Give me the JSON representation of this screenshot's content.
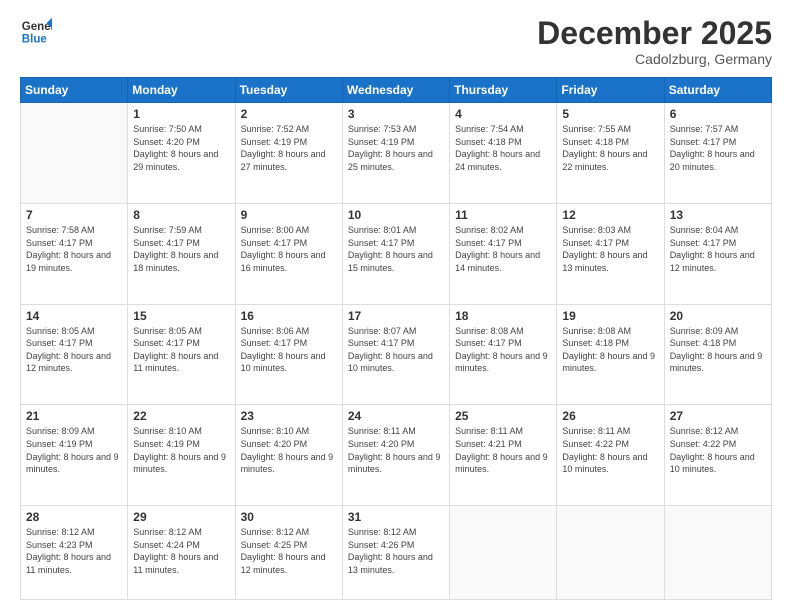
{
  "header": {
    "logo_line1": "General",
    "logo_line2": "Blue",
    "month_year": "December 2025",
    "location": "Cadolzburg, Germany"
  },
  "days_of_week": [
    "Sunday",
    "Monday",
    "Tuesday",
    "Wednesday",
    "Thursday",
    "Friday",
    "Saturday"
  ],
  "weeks": [
    [
      {
        "day": "",
        "sunrise": "",
        "sunset": "",
        "daylight": ""
      },
      {
        "day": "1",
        "sunrise": "Sunrise: 7:50 AM",
        "sunset": "Sunset: 4:20 PM",
        "daylight": "Daylight: 8 hours and 29 minutes."
      },
      {
        "day": "2",
        "sunrise": "Sunrise: 7:52 AM",
        "sunset": "Sunset: 4:19 PM",
        "daylight": "Daylight: 8 hours and 27 minutes."
      },
      {
        "day": "3",
        "sunrise": "Sunrise: 7:53 AM",
        "sunset": "Sunset: 4:19 PM",
        "daylight": "Daylight: 8 hours and 25 minutes."
      },
      {
        "day": "4",
        "sunrise": "Sunrise: 7:54 AM",
        "sunset": "Sunset: 4:18 PM",
        "daylight": "Daylight: 8 hours and 24 minutes."
      },
      {
        "day": "5",
        "sunrise": "Sunrise: 7:55 AM",
        "sunset": "Sunset: 4:18 PM",
        "daylight": "Daylight: 8 hours and 22 minutes."
      },
      {
        "day": "6",
        "sunrise": "Sunrise: 7:57 AM",
        "sunset": "Sunset: 4:17 PM",
        "daylight": "Daylight: 8 hours and 20 minutes."
      }
    ],
    [
      {
        "day": "7",
        "sunrise": "Sunrise: 7:58 AM",
        "sunset": "Sunset: 4:17 PM",
        "daylight": "Daylight: 8 hours and 19 minutes."
      },
      {
        "day": "8",
        "sunrise": "Sunrise: 7:59 AM",
        "sunset": "Sunset: 4:17 PM",
        "daylight": "Daylight: 8 hours and 18 minutes."
      },
      {
        "day": "9",
        "sunrise": "Sunrise: 8:00 AM",
        "sunset": "Sunset: 4:17 PM",
        "daylight": "Daylight: 8 hours and 16 minutes."
      },
      {
        "day": "10",
        "sunrise": "Sunrise: 8:01 AM",
        "sunset": "Sunset: 4:17 PM",
        "daylight": "Daylight: 8 hours and 15 minutes."
      },
      {
        "day": "11",
        "sunrise": "Sunrise: 8:02 AM",
        "sunset": "Sunset: 4:17 PM",
        "daylight": "Daylight: 8 hours and 14 minutes."
      },
      {
        "day": "12",
        "sunrise": "Sunrise: 8:03 AM",
        "sunset": "Sunset: 4:17 PM",
        "daylight": "Daylight: 8 hours and 13 minutes."
      },
      {
        "day": "13",
        "sunrise": "Sunrise: 8:04 AM",
        "sunset": "Sunset: 4:17 PM",
        "daylight": "Daylight: 8 hours and 12 minutes."
      }
    ],
    [
      {
        "day": "14",
        "sunrise": "Sunrise: 8:05 AM",
        "sunset": "Sunset: 4:17 PM",
        "daylight": "Daylight: 8 hours and 12 minutes."
      },
      {
        "day": "15",
        "sunrise": "Sunrise: 8:05 AM",
        "sunset": "Sunset: 4:17 PM",
        "daylight": "Daylight: 8 hours and 11 minutes."
      },
      {
        "day": "16",
        "sunrise": "Sunrise: 8:06 AM",
        "sunset": "Sunset: 4:17 PM",
        "daylight": "Daylight: 8 hours and 10 minutes."
      },
      {
        "day": "17",
        "sunrise": "Sunrise: 8:07 AM",
        "sunset": "Sunset: 4:17 PM",
        "daylight": "Daylight: 8 hours and 10 minutes."
      },
      {
        "day": "18",
        "sunrise": "Sunrise: 8:08 AM",
        "sunset": "Sunset: 4:17 PM",
        "daylight": "Daylight: 8 hours and 9 minutes."
      },
      {
        "day": "19",
        "sunrise": "Sunrise: 8:08 AM",
        "sunset": "Sunset: 4:18 PM",
        "daylight": "Daylight: 8 hours and 9 minutes."
      },
      {
        "day": "20",
        "sunrise": "Sunrise: 8:09 AM",
        "sunset": "Sunset: 4:18 PM",
        "daylight": "Daylight: 8 hours and 9 minutes."
      }
    ],
    [
      {
        "day": "21",
        "sunrise": "Sunrise: 8:09 AM",
        "sunset": "Sunset: 4:19 PM",
        "daylight": "Daylight: 8 hours and 9 minutes."
      },
      {
        "day": "22",
        "sunrise": "Sunrise: 8:10 AM",
        "sunset": "Sunset: 4:19 PM",
        "daylight": "Daylight: 8 hours and 9 minutes."
      },
      {
        "day": "23",
        "sunrise": "Sunrise: 8:10 AM",
        "sunset": "Sunset: 4:20 PM",
        "daylight": "Daylight: 8 hours and 9 minutes."
      },
      {
        "day": "24",
        "sunrise": "Sunrise: 8:11 AM",
        "sunset": "Sunset: 4:20 PM",
        "daylight": "Daylight: 8 hours and 9 minutes."
      },
      {
        "day": "25",
        "sunrise": "Sunrise: 8:11 AM",
        "sunset": "Sunset: 4:21 PM",
        "daylight": "Daylight: 8 hours and 9 minutes."
      },
      {
        "day": "26",
        "sunrise": "Sunrise: 8:11 AM",
        "sunset": "Sunset: 4:22 PM",
        "daylight": "Daylight: 8 hours and 10 minutes."
      },
      {
        "day": "27",
        "sunrise": "Sunrise: 8:12 AM",
        "sunset": "Sunset: 4:22 PM",
        "daylight": "Daylight: 8 hours and 10 minutes."
      }
    ],
    [
      {
        "day": "28",
        "sunrise": "Sunrise: 8:12 AM",
        "sunset": "Sunset: 4:23 PM",
        "daylight": "Daylight: 8 hours and 11 minutes."
      },
      {
        "day": "29",
        "sunrise": "Sunrise: 8:12 AM",
        "sunset": "Sunset: 4:24 PM",
        "daylight": "Daylight: 8 hours and 11 minutes."
      },
      {
        "day": "30",
        "sunrise": "Sunrise: 8:12 AM",
        "sunset": "Sunset: 4:25 PM",
        "daylight": "Daylight: 8 hours and 12 minutes."
      },
      {
        "day": "31",
        "sunrise": "Sunrise: 8:12 AM",
        "sunset": "Sunset: 4:26 PM",
        "daylight": "Daylight: 8 hours and 13 minutes."
      },
      {
        "day": "",
        "sunrise": "",
        "sunset": "",
        "daylight": ""
      },
      {
        "day": "",
        "sunrise": "",
        "sunset": "",
        "daylight": ""
      },
      {
        "day": "",
        "sunrise": "",
        "sunset": "",
        "daylight": ""
      }
    ]
  ]
}
